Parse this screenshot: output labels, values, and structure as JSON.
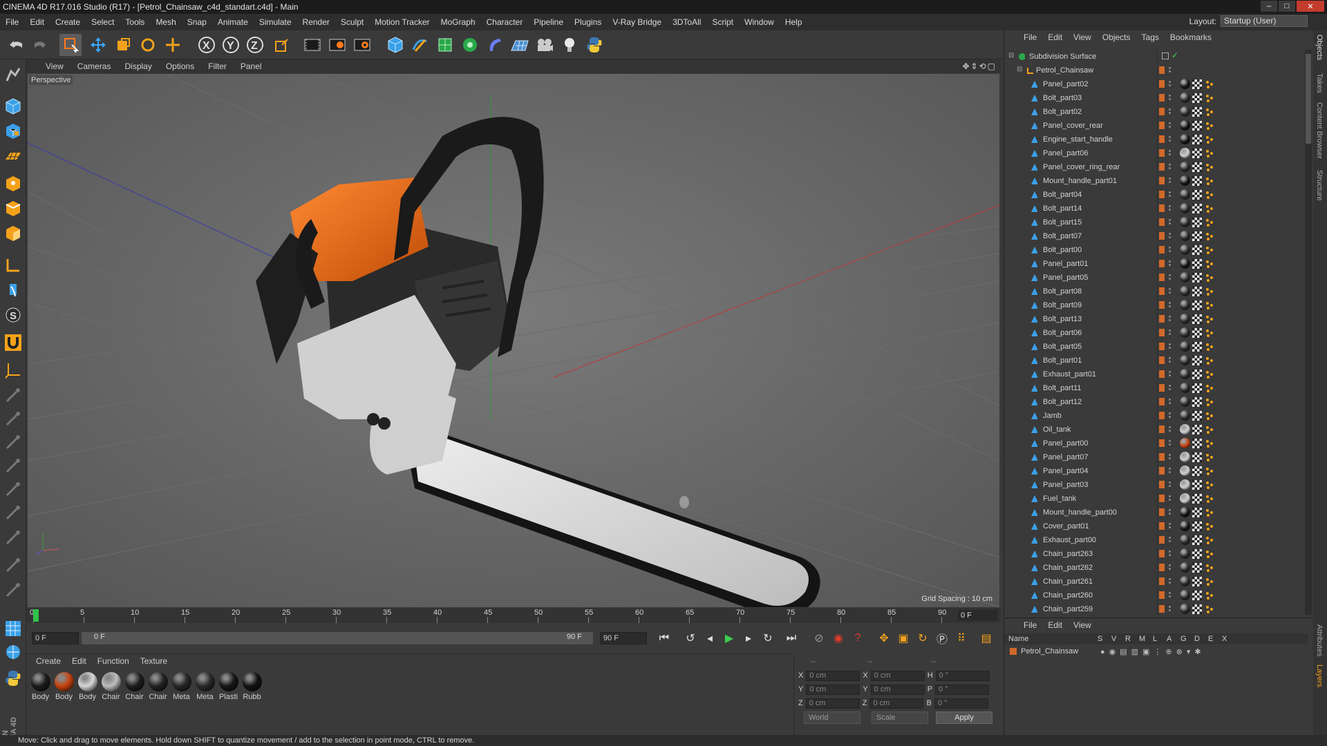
{
  "window": {
    "title": "CINEMA 4D R17.016 Studio (R17) - [Petrol_Chainsaw_c4d_standart.c4d] - Main"
  },
  "menu": [
    "File",
    "Edit",
    "Create",
    "Select",
    "Tools",
    "Mesh",
    "Snap",
    "Animate",
    "Simulate",
    "Render",
    "Sculpt",
    "Motion Tracker",
    "MoGraph",
    "Character",
    "Pipeline",
    "Plugins",
    "V-Ray Bridge",
    "3DToAll",
    "Script",
    "Window",
    "Help"
  ],
  "layout": {
    "label": "Layout:",
    "value": "Startup (User)"
  },
  "viewport": {
    "menu": [
      "View",
      "Cameras",
      "Display",
      "Options",
      "Filter",
      "Panel"
    ],
    "label": "Perspective",
    "grid_spacing": "Grid Spacing : 10 cm"
  },
  "timeline": {
    "ticks": [
      "0",
      "5",
      "10",
      "15",
      "20",
      "25",
      "30",
      "35",
      "40",
      "45",
      "50",
      "55",
      "60",
      "65",
      "70",
      "75",
      "80",
      "85",
      "90"
    ],
    "current_frame": "0 F"
  },
  "transport": {
    "start": "0 F",
    "slider_start": "0 F",
    "slider_end": "90 F",
    "end": "90 F"
  },
  "materials": {
    "menu": [
      "Create",
      "Edit",
      "Function",
      "Texture"
    ],
    "items": [
      {
        "name": "Body",
        "color": "#1c1c1c"
      },
      {
        "name": "Body",
        "color": "#c8420e"
      },
      {
        "name": "Body",
        "color": "#d8d8d8"
      },
      {
        "name": "Chair",
        "color": "#bdbdbd"
      },
      {
        "name": "Chair",
        "color": "#1e1e1e"
      },
      {
        "name": "Chair",
        "color": "#232323"
      },
      {
        "name": "Meta",
        "color": "#262626"
      },
      {
        "name": "Meta",
        "color": "#2a2a2a"
      },
      {
        "name": "Plasti",
        "color": "#161616"
      },
      {
        "name": "Rubb",
        "color": "#121212"
      }
    ]
  },
  "coords": {
    "headers": [
      "--",
      "--",
      "--"
    ],
    "rows": [
      {
        "a": "X",
        "av": "0 cm",
        "b": "X",
        "bv": "0 cm",
        "c": "H",
        "cv": "0 °"
      },
      {
        "a": "Y",
        "av": "0 cm",
        "b": "Y",
        "bv": "0 cm",
        "c": "P",
        "cv": "0 °"
      },
      {
        "a": "Z",
        "av": "0 cm",
        "b": "Z",
        "bv": "0 cm",
        "c": "B",
        "cv": "0 °"
      }
    ],
    "world": "World",
    "scale": "Scale",
    "apply": "Apply"
  },
  "status": "Move: Click and drag to move elements. Hold down SHIFT to quantize movement / add to the selection in point mode, CTRL to remove.",
  "objects": {
    "menu": [
      "File",
      "Edit",
      "View",
      "Objects",
      "Tags",
      "Bookmarks"
    ],
    "root": "Subdivision Surface",
    "group": "Petrol_Chainsaw",
    "items": [
      {
        "name": "Panel_part02",
        "mat": "#151515"
      },
      {
        "name": "Bolt_part03",
        "mat": "#2a2a2a"
      },
      {
        "name": "Bolt_part02",
        "mat": "#2a2a2a"
      },
      {
        "name": "Panel_cover_rear",
        "mat": "#151515"
      },
      {
        "name": "Engine_start_handle",
        "mat": "#151515"
      },
      {
        "name": "Panel_part06",
        "mat": "#cfcfcf"
      },
      {
        "name": "Panel_cover_ring_rear",
        "mat": "#2a2a2a"
      },
      {
        "name": "Mount_handle_part01",
        "mat": "#151515"
      },
      {
        "name": "Bolt_part04",
        "mat": "#2a2a2a"
      },
      {
        "name": "Bolt_part14",
        "mat": "#2a2a2a"
      },
      {
        "name": "Bolt_part15",
        "mat": "#2a2a2a"
      },
      {
        "name": "Bolt_part07",
        "mat": "#2a2a2a"
      },
      {
        "name": "Bolt_part00",
        "mat": "#2a2a2a"
      },
      {
        "name": "Panel_part01",
        "mat": "#151515"
      },
      {
        "name": "Panel_part05",
        "mat": "#2a2a2a"
      },
      {
        "name": "Bolt_part08",
        "mat": "#2a2a2a"
      },
      {
        "name": "Bolt_part09",
        "mat": "#2a2a2a"
      },
      {
        "name": "Bolt_part13",
        "mat": "#2a2a2a"
      },
      {
        "name": "Bolt_part06",
        "mat": "#2a2a2a"
      },
      {
        "name": "Bolt_part05",
        "mat": "#2a2a2a"
      },
      {
        "name": "Bolt_part01",
        "mat": "#2a2a2a"
      },
      {
        "name": "Exhaust_part01",
        "mat": "#2a2a2a"
      },
      {
        "name": "Bolt_part11",
        "mat": "#2a2a2a"
      },
      {
        "name": "Bolt_part12",
        "mat": "#2a2a2a"
      },
      {
        "name": "Jamb",
        "mat": "#2a2a2a"
      },
      {
        "name": "Oil_tank",
        "mat": "#cfcfcf"
      },
      {
        "name": "Panel_part00",
        "mat": "#c8420e"
      },
      {
        "name": "Panel_part07",
        "mat": "#cfcfcf"
      },
      {
        "name": "Panel_part04",
        "mat": "#cfcfcf"
      },
      {
        "name": "Panel_part03",
        "mat": "#cfcfcf"
      },
      {
        "name": "Fuel_tank",
        "mat": "#cfcfcf"
      },
      {
        "name": "Mount_handle_part00",
        "mat": "#151515"
      },
      {
        "name": "Cover_part01",
        "mat": "#151515"
      },
      {
        "name": "Exhaust_part00",
        "mat": "#2a2a2a"
      },
      {
        "name": "Chain_part263",
        "mat": "#2a2a2a"
      },
      {
        "name": "Chain_part262",
        "mat": "#2a2a2a"
      },
      {
        "name": "Chain_part261",
        "mat": "#2a2a2a"
      },
      {
        "name": "Chain_part260",
        "mat": "#2a2a2a"
      },
      {
        "name": "Chain_part259",
        "mat": "#2a2a2a"
      }
    ]
  },
  "side_tabs": [
    "Objects",
    "Takes",
    "Content Browser",
    "Structure",
    "Attributes",
    "Layers"
  ],
  "layers": {
    "menu": [
      "File",
      "Edit",
      "View"
    ],
    "headers": [
      "Name",
      "S",
      "V",
      "R",
      "M",
      "L",
      "A",
      "G",
      "D",
      "E",
      "X"
    ],
    "row": "Petrol_Chainsaw"
  },
  "colors": {
    "accent_orange": "#d2692a",
    "bg": "#3a3a3a",
    "viewport": "#5d5d5d"
  }
}
